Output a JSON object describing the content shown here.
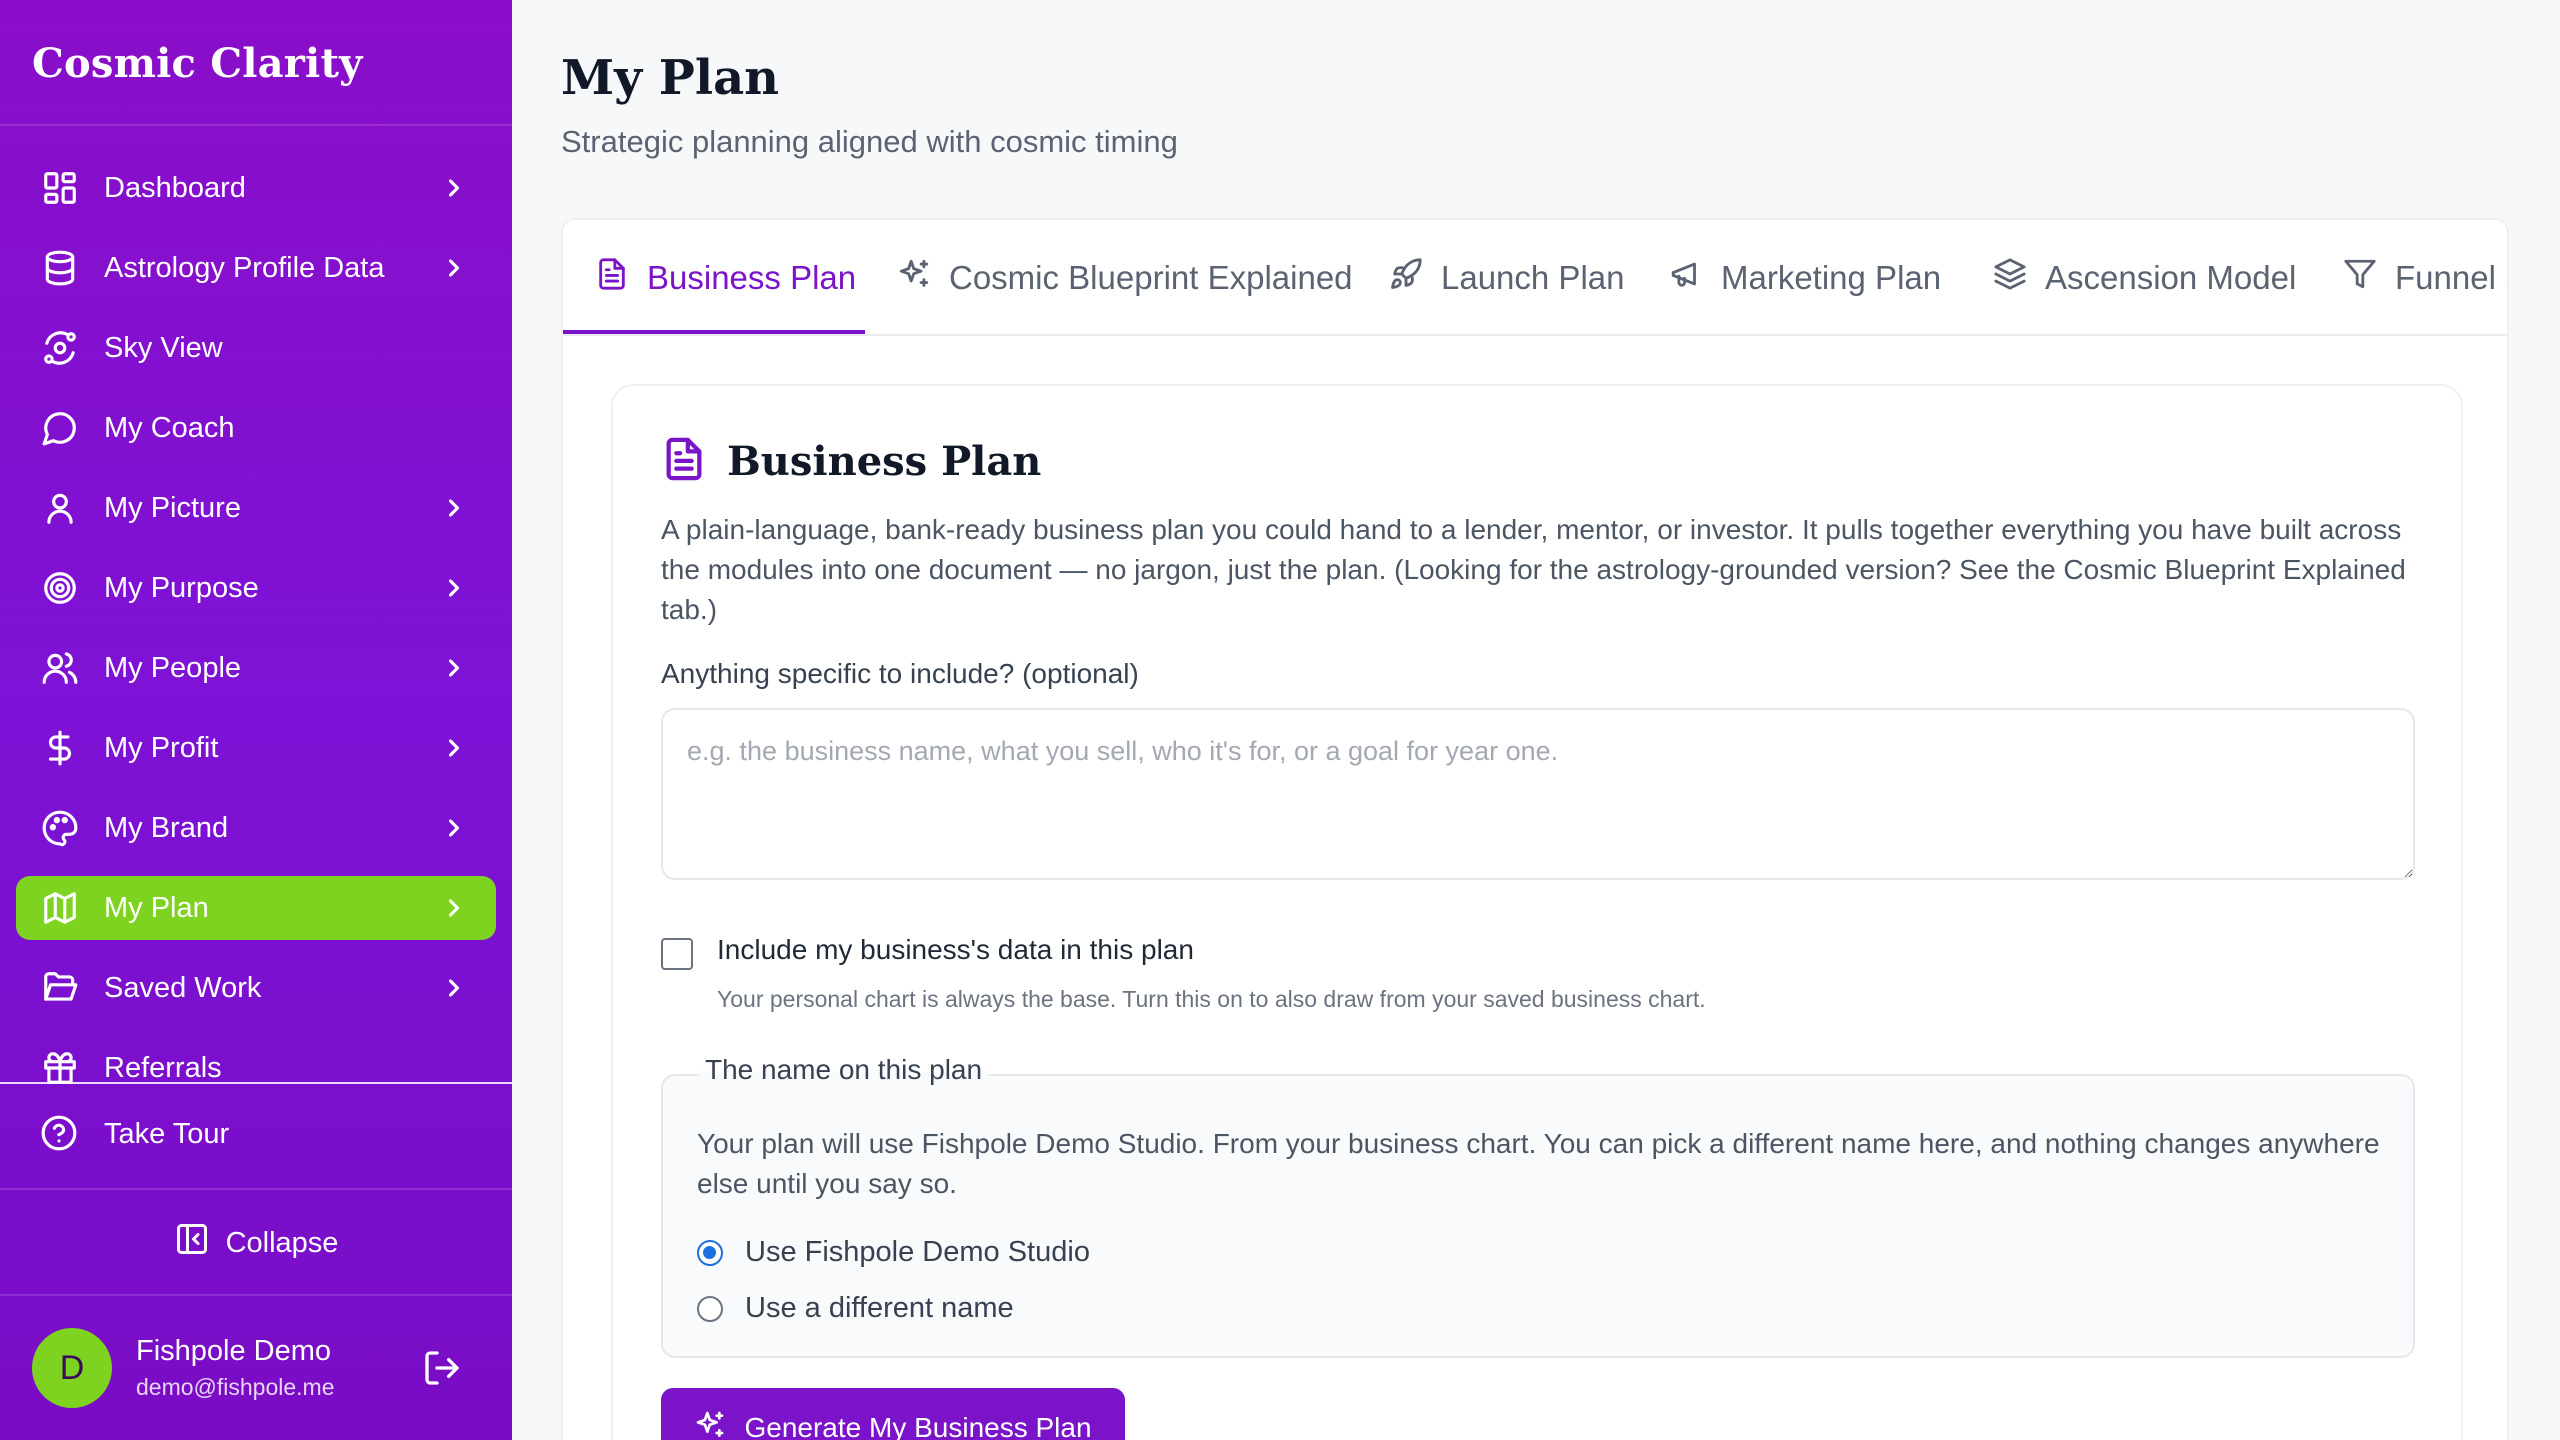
{
  "app": {
    "name": "Cosmic Clarity"
  },
  "sidebar": {
    "items": [
      {
        "label": "Dashboard",
        "icon": "grid-icon",
        "chevron": true
      },
      {
        "label": "Astrology Profile Data",
        "icon": "database-icon",
        "chevron": true
      },
      {
        "label": "Sky View",
        "icon": "orbit-icon",
        "chevron": false
      },
      {
        "label": "My Coach",
        "icon": "chat-bubble-icon",
        "chevron": false
      },
      {
        "label": "My Picture",
        "icon": "user-icon",
        "chevron": true
      },
      {
        "label": "My Purpose",
        "icon": "target-icon",
        "chevron": true
      },
      {
        "label": "My People",
        "icon": "users-icon",
        "chevron": true
      },
      {
        "label": "My Profit",
        "icon": "dollar-icon",
        "chevron": true
      },
      {
        "label": "My Brand",
        "icon": "palette-icon",
        "chevron": true
      },
      {
        "label": "My Plan",
        "icon": "map-icon",
        "chevron": true,
        "active": true
      },
      {
        "label": "Saved Work",
        "icon": "folder-open-icon",
        "chevron": true
      },
      {
        "label": "Referrals",
        "icon": "gift-icon",
        "chevron": false
      }
    ],
    "tour_label": "Take Tour",
    "collapse_label": "Collapse",
    "active_color": "#7ed321"
  },
  "user": {
    "initial": "D",
    "name": "Fishpole Demo",
    "email": "demo@fishpole.me"
  },
  "page": {
    "title": "My Plan",
    "subtitle": "Strategic planning aligned with cosmic timing"
  },
  "tabs": [
    {
      "label": "Business Plan",
      "icon": "document-icon",
      "active": true
    },
    {
      "label": "Cosmic Blueprint Explained",
      "icon": "sparkles-icon"
    },
    {
      "label": "Launch Plan",
      "icon": "rocket-icon"
    },
    {
      "label": "Marketing Plan",
      "icon": "megaphone-icon"
    },
    {
      "label": "Ascension Model",
      "icon": "layers-icon"
    },
    {
      "label": "Funnel S",
      "icon": "funnel-icon"
    }
  ],
  "card": {
    "title": "Business Plan",
    "description": "A plain-language, bank-ready business plan you could hand to a lender, mentor, or investor. It pulls together everything you have built across the modules into one document — no jargon, just the plan. (Looking for the astrology-grounded version? See the Cosmic Blueprint Explained tab.)",
    "include_label": "Anything specific to include? (optional)",
    "include_placeholder": "e.g. the business name, what you sell, who it's for, or a goal for year one.",
    "include_value": "",
    "checkbox_label": "Include my business's data in this plan",
    "checkbox_checked": false,
    "checkbox_hint": "Your personal chart is always the base. Turn this on to also draw from your saved business chart.",
    "name_legend": "The name on this plan",
    "name_text": "Your plan will use Fishpole Demo Studio. From your business chart. You can pick a different name here, and nothing changes anywhere else until you say so.",
    "radio_options": [
      {
        "label": "Use Fishpole Demo Studio",
        "checked": true
      },
      {
        "label": "Use a different name",
        "checked": false
      }
    ],
    "generate_label": "Generate My Business Plan"
  },
  "colors": {
    "brand": "#7b14c8",
    "sidebar": "#8a0ec9",
    "accent": "#7ed321"
  }
}
